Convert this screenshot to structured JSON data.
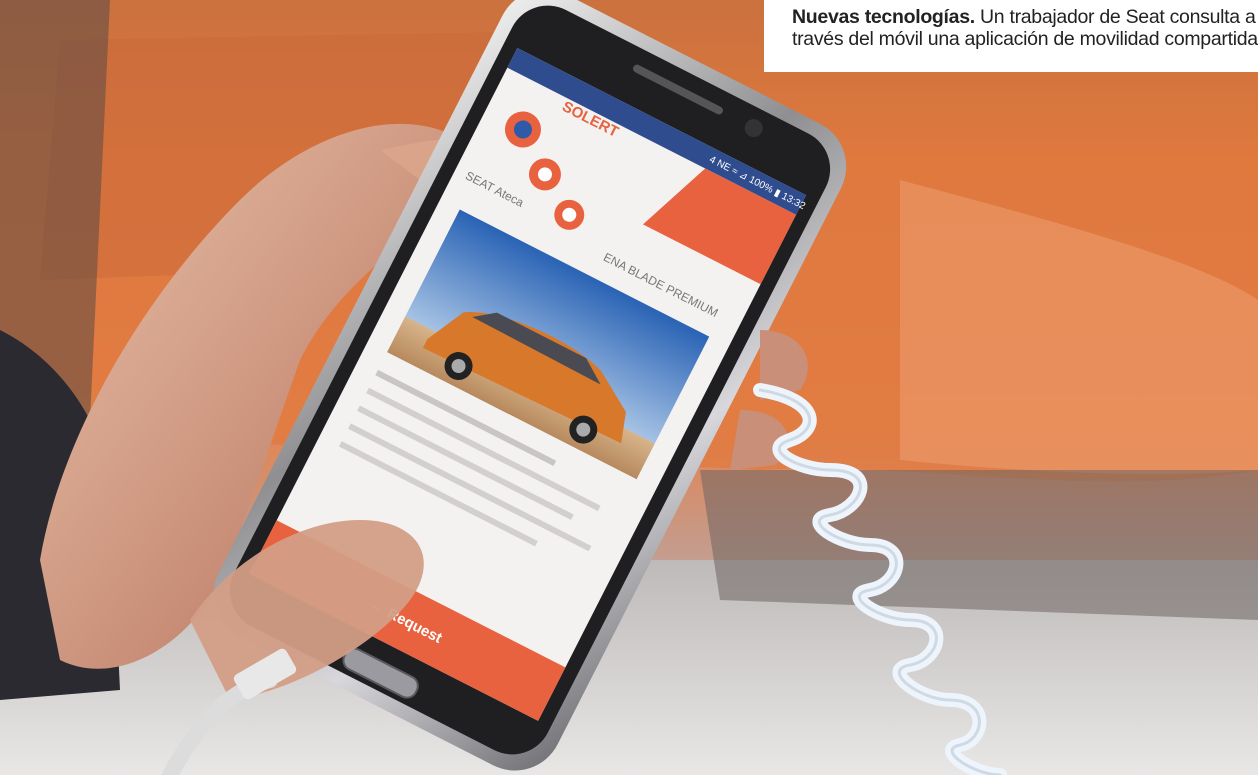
{
  "caption": {
    "lead": "Nuevas tecnologías.",
    "line1": "Un trabajador de Seat consulta a",
    "line2": "través del móvil una aplicación de movilidad compartida."
  },
  "phone_screen": {
    "brand": "SOLERT",
    "model_label": "SEAT Ateca",
    "headline": "ENA BLADE PREMIUM",
    "status_bar": "4 NE ≈ ⊿ 100% ▮ 13:32",
    "button_label": "← Request"
  },
  "colors": {
    "accent": "#e8623f",
    "background_car": "#e27a3c",
    "screen_blue": "#2f5aa8"
  }
}
